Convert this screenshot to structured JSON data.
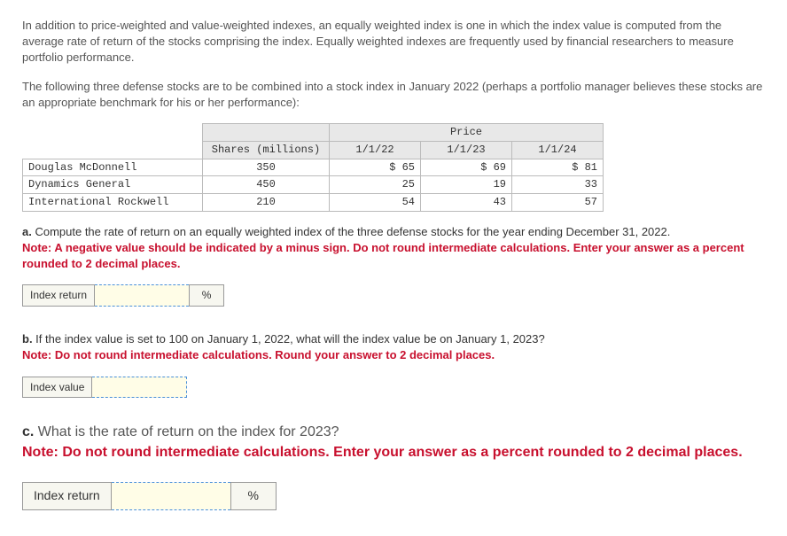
{
  "intro": {
    "p1": "In addition to price-weighted and value-weighted indexes, an equally weighted index is one in which the index value is computed from the average rate of return of the stocks comprising the index. Equally weighted indexes are frequently used by financial researchers to measure portfolio performance.",
    "p2": "The following three defense stocks are to be combined into a stock index in January 2022 (perhaps a portfolio manager believes these stocks are an appropriate benchmark for his or her performance):"
  },
  "table": {
    "header_group": "Price",
    "shares_header": "Shares (millions)",
    "date1": "1/1/22",
    "date2": "1/1/23",
    "date3": "1/1/24",
    "rows": [
      {
        "name": "Douglas McDonnell",
        "shares": "350",
        "p1": "$ 65",
        "p2": "$ 69",
        "p3": "$ 81"
      },
      {
        "name": "Dynamics General",
        "shares": "450",
        "p1": "25",
        "p2": "19",
        "p3": "33"
      },
      {
        "name": "International Rockwell",
        "shares": "210",
        "p1": "54",
        "p2": "43",
        "p3": "57"
      }
    ]
  },
  "qa": {
    "label": "a.",
    "text": " Compute the rate of return on an equally weighted index of the three defense stocks for the year ending December 31, 2022.",
    "note": "Note: A negative value should be indicated by a minus sign. Do not round intermediate calculations. Enter your answer as a percent rounded to 2 decimal places.",
    "field_label": "Index return",
    "unit": "%"
  },
  "qb": {
    "label": "b.",
    "text": " If the index value is set to 100 on January 1, 2022, what will the index value be on January 1, 2023?",
    "note": "Note: Do not round intermediate calculations. Round your answer to 2 decimal places.",
    "field_label": "Index value"
  },
  "qc": {
    "label": "c.",
    "text": " What is the rate of return on the index for 2023?",
    "note": "Note: Do not round intermediate calculations. Enter your answer as a percent rounded to 2 decimal places.",
    "field_label": "Index return",
    "unit": "%"
  }
}
